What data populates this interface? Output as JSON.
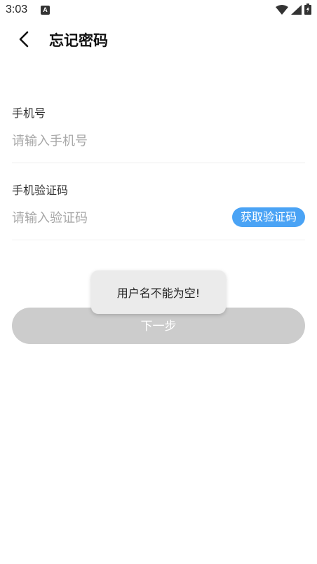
{
  "status_bar": {
    "time": "3:03",
    "a_icon_label": "A",
    "icons": [
      "notification-a-icon",
      "wifi-icon",
      "signal-icon",
      "battery-charging-icon"
    ]
  },
  "header": {
    "title": "忘记密码",
    "back_icon": "chevron-left-icon"
  },
  "form": {
    "phone": {
      "label": "手机号",
      "placeholder": "请输入手机号",
      "value": ""
    },
    "code": {
      "label": "手机验证码",
      "placeholder": "请输入验证码",
      "value": "",
      "get_code_label": "获取验证码"
    },
    "next_label": "下一步"
  },
  "toast": {
    "message": "用户名不能为空!"
  },
  "colors": {
    "accent": "#4aa3f5",
    "disabled_button": "#cccccc",
    "placeholder": "#a8a8a8",
    "toast_bg": "#ebebeb"
  }
}
